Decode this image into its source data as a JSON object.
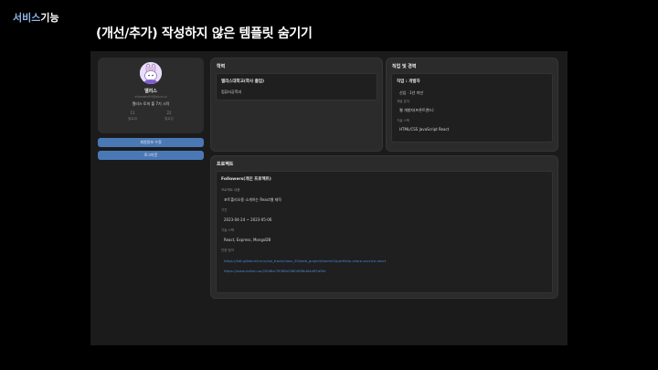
{
  "slide": {
    "tag_part1": "서비스",
    "tag_part2": "기능",
    "title": "(개선/추가) 작성하지 않은 템플릿 숨기기"
  },
  "profile": {
    "name": "앨리스",
    "email": "elicedev99@elice.io",
    "intro": "앨리스 토끼 풀 7기 시작",
    "stats": [
      {
        "count": "11",
        "label": "팔로워"
      },
      {
        "count": "22",
        "label": "팔로잉"
      }
    ]
  },
  "actions": {
    "edit_profile": "회원정보 수정",
    "logout": "로그아웃"
  },
  "education": {
    "title": "학력",
    "school": "앨리스대학교(학사 졸업)",
    "major": "컴퓨터공학과"
  },
  "career": {
    "title": "직업 및 경력",
    "job": "직업 : 개발자",
    "level": "신입 · 1년 미만",
    "field_label": "개발 분야",
    "field_value": "웹 개발자(프론트엔드)",
    "stack_label": "기술 스택",
    "stack_value": "HTML/CSS  JavaScript  React"
  },
  "project": {
    "title": "프로젝트",
    "name": "Followers(개인 프로젝트)",
    "desc_label": "프로젝트 내용",
    "desc_value": "포트폴리오용 소개하는 React웹 제작",
    "period_label": "기간",
    "period_value": "2023-04-24 ~ 2023-05-06",
    "stack_label": "기술 스택",
    "stack_value": "React, Express, MongoDB",
    "links_label": "관련 링크",
    "links": [
      "https://kdt-gitlab.elice.io/sw_track/class_05/web_project/team02/portfolio-share-service-react",
      "https://www.notion.so/2008bc7838fe29800f66dd4dff1df0e"
    ]
  }
}
